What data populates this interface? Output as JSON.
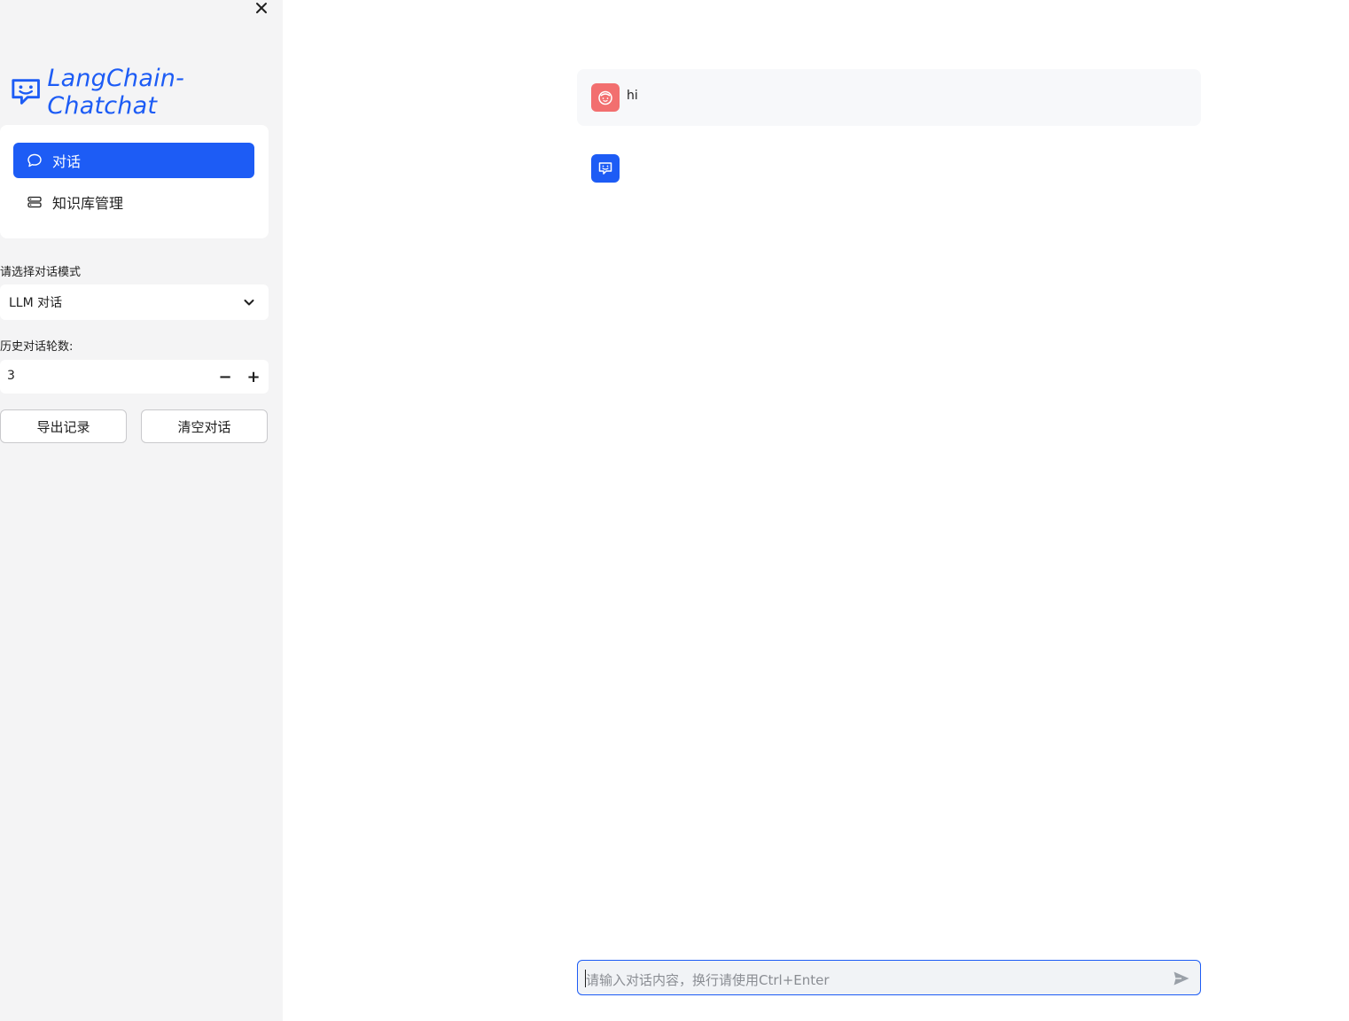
{
  "app": {
    "logo_text": "LangChain-Chatchat",
    "brand_color": "#1d5cf5",
    "icons": {
      "close": "close-icon",
      "logo": "chat-bubble-face-icon",
      "nav_chat": "speech-bubble-icon",
      "nav_kb": "database-icon",
      "select": "chevron-down-icon",
      "send": "send-icon",
      "user_avatar": "face-icon",
      "assistant_avatar": "chat-bubble-face-icon"
    }
  },
  "sidebar": {
    "nav": {
      "items": [
        {
          "label": "对话",
          "active": true
        },
        {
          "label": "知识库管理",
          "active": false
        }
      ]
    },
    "mode": {
      "label": "请选择对话模式",
      "selected": "LLM 对话"
    },
    "history": {
      "label": "历史对话轮数:",
      "value": "3",
      "minus": "−",
      "plus": "+"
    },
    "buttons": {
      "export": "导出记录",
      "clear": "清空对话"
    }
  },
  "chat": {
    "messages": [
      {
        "role": "user",
        "text": "hi",
        "avatar_color": "#f26f6f"
      },
      {
        "role": "assistant",
        "text": "",
        "avatar_color": "#1d5cf5"
      }
    ],
    "input": {
      "placeholder": "请输入对话内容，换行请使用Ctrl+Enter"
    }
  }
}
